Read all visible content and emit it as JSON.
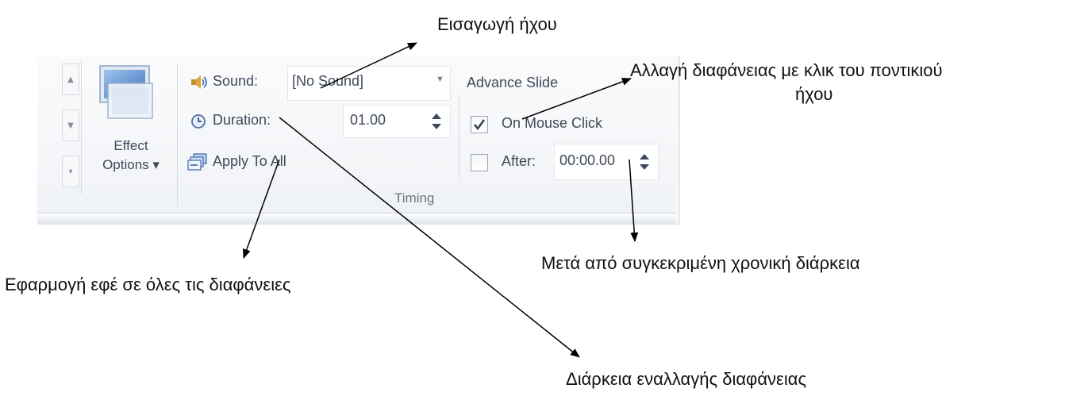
{
  "ribbon": {
    "gallery": {
      "scroll_up": "▲",
      "scroll_down": "▼",
      "more": "▾"
    },
    "effect_options": {
      "label_line1": "Effect",
      "label_line2": "Options ▾"
    },
    "sound": {
      "label": "Sound:",
      "value": "[No Sound]"
    },
    "duration": {
      "label": "Duration:",
      "value": "01.00"
    },
    "apply_to_all": {
      "label": "Apply To All"
    },
    "advance_slide": {
      "heading": "Advance Slide",
      "on_mouse_click": {
        "label": "On Mouse Click",
        "checked": true
      },
      "after": {
        "label": "After:",
        "value": "00:00.00",
        "checked": false
      }
    },
    "group_label": "Timing"
  },
  "callouts": {
    "insert_sound": "Εισαγωγή ήχου",
    "mouse_click_line1": "Αλλαγή διαφάνειας με κλικ του ποντικιού",
    "mouse_click_line2": "ήχου",
    "after_time": "Μετά από συγκεκριμένη χρονική διάρκεια",
    "apply_all": "Εφαρμογή εφέ σε όλες τις διαφάνειες",
    "duration": "Διάρκεια εναλλαγής διαφάνειας"
  },
  "icons": {
    "sound": "speaker-icon",
    "duration": "clock-icon",
    "apply_to_all": "apply-all-icon",
    "spinner": "spinner-arrows-icon",
    "dropdown": "dropdown-arrow-icon"
  }
}
